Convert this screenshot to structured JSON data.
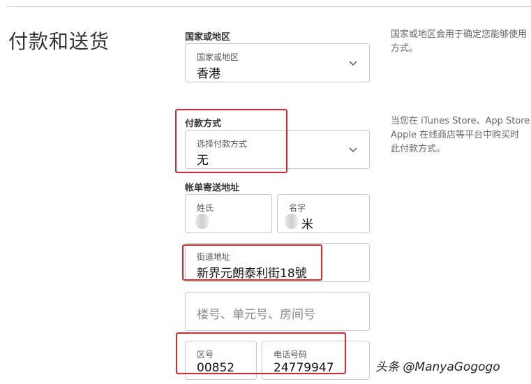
{
  "page_title": "付款和送货",
  "country": {
    "section_label": "国家或地区",
    "field_label": "国家或地区",
    "value": "香港",
    "help": [
      "国家或地区会用于确定您能够使用",
      "方式。"
    ]
  },
  "payment": {
    "section_label": "付款方式",
    "field_label": "选择付款方式",
    "value": "无",
    "help": [
      "当您在 iTunes Store、App Store",
      "Apple 在线商店等平台中购买时",
      "此付款方式。"
    ]
  },
  "billing": {
    "section_label": "帐单寄送地址",
    "last_name_label": "姓氏",
    "first_name_label": "名字",
    "first_name_value": "米",
    "street_label": "街道地址",
    "street_value": "新界元朗泰利街18號",
    "unit_placeholder": "楼号、单元号、房间号",
    "area_code_label": "区号",
    "area_code_value": "00852",
    "phone_label": "电话号码",
    "phone_value": "24779947"
  },
  "watermark": "头条 @ManyaGogogo",
  "colors": {
    "highlight": "#e0252b",
    "border": "#c8c8cc"
  }
}
